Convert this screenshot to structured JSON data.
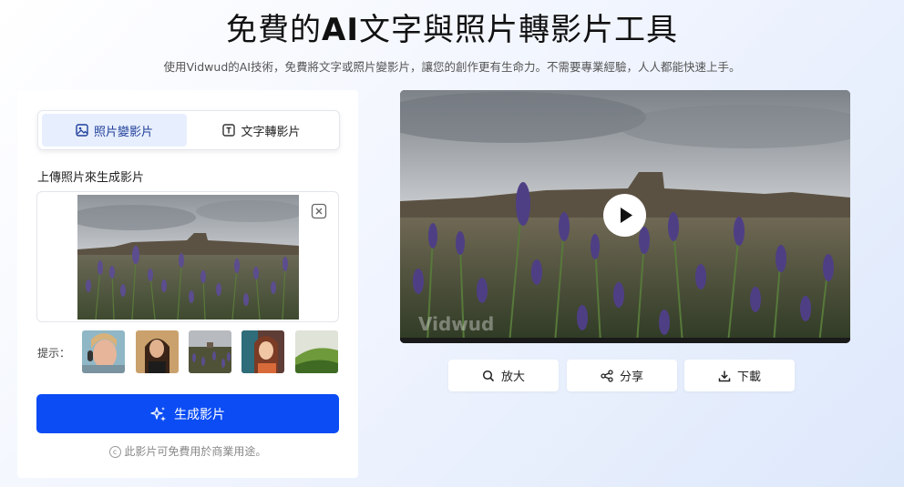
{
  "header": {
    "title_pre": "免費的",
    "title_bold": "AI",
    "title_post": "文字與照片轉影片工具",
    "subtitle": "使用Vidwud的AI技術，免費將文字或照片變影片，讓您的創作更有生命力。不需要專業經驗，人人都能快速上手。"
  },
  "left_panel": {
    "tabs": [
      {
        "label": "照片變影片",
        "icon": "image-icon",
        "active": true
      },
      {
        "label": "文字轉影片",
        "icon": "text-icon",
        "active": false
      }
    ],
    "upload_label": "上傳照片來生成影片",
    "hint_label": "提示：",
    "generate_label": "生成影片",
    "note": "此影片可免費用於商業用途。"
  },
  "video": {
    "watermark": "Vidwud"
  },
  "actions": {
    "zoom": "放大",
    "share": "分享",
    "download": "下載"
  },
  "colors": {
    "accent": "#0b4cf4",
    "active_tab_bg": "#e7eefd"
  }
}
